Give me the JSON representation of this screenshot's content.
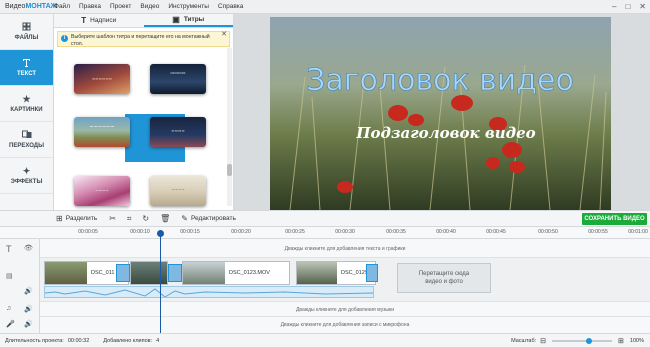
{
  "app": {
    "logo_part1": "Видео",
    "logo_part2": "МОНТАЖ",
    "menu": [
      "Файл",
      "Правка",
      "Проект",
      "Видео",
      "Инструменты",
      "Справка"
    ]
  },
  "window_controls": [
    "–",
    "□",
    "✕"
  ],
  "sidebar": {
    "items": [
      {
        "label": "ФАЙЛЫ",
        "icon": "files-icon"
      },
      {
        "label": "ТЕКСТ",
        "icon": "text-icon",
        "active": true
      },
      {
        "label": "КАРТИНКИ",
        "icon": "star-icon"
      },
      {
        "label": "ПЕРЕХОДЫ",
        "icon": "transitions-icon"
      },
      {
        "label": "ЭФФЕКТЫ",
        "icon": "effects-icon"
      }
    ]
  },
  "library": {
    "tabs": [
      {
        "label": "Надписи",
        "icon": "text-t-icon"
      },
      {
        "label": "Титры",
        "icon": "title-icon",
        "active": true
      }
    ],
    "hint_line1": "Выберите шаблон титра и перетащите его на монтажный",
    "hint_line2": "стол."
  },
  "preview": {
    "title": "Заголовок видео",
    "subtitle": "Подзаголовок видео"
  },
  "toolbar": {
    "split_label": "Разделить",
    "edit_label": "Редактировать",
    "save_label": "СОХРАНИТЬ ВИДЕО"
  },
  "ruler": {
    "ticks": [
      "00:00:05",
      "00:00:10",
      "00:00:15",
      "00:00:20",
      "00:00:25",
      "00:00:30",
      "00:00:35",
      "00:00:40",
      "00:00:45",
      "00:00:50",
      "00:00:55",
      "00:01:00"
    ]
  },
  "timeline": {
    "text_track_hint": "Дважды кликните для добавления текста и графики",
    "clips": [
      "DSC_011",
      "DSC_0123.MOV",
      "DSC_0129"
    ],
    "dropzone_line1": "Перетащите сюда",
    "dropzone_line2": "видео и фото",
    "music_hint": "Дважды кликните для добавления музыки",
    "mic_hint": "Дважды кликните для добавления записи с микрофона"
  },
  "status": {
    "duration_label": "Длительность проекта:",
    "duration_value": "00:00:32",
    "clips_label": "Добавлено клипов:",
    "clips_value": "4",
    "zoom_label": "Масштаб:",
    "zoom_value": "100%"
  },
  "colors": {
    "accent": "#1f94d6",
    "save_button": "#1aab3a",
    "playhead": "#1a5aa8"
  }
}
